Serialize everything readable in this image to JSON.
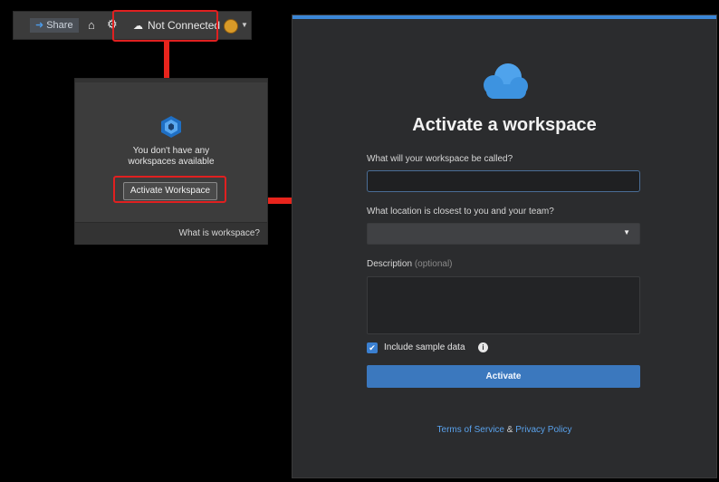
{
  "toolbar": {
    "share_label": "Share",
    "status_label": "Not Connected",
    "icons": [
      "share-arrow-icon",
      "home-icon",
      "gear-icon",
      "disconnected-icon",
      "avatar",
      "caret-down-icon"
    ]
  },
  "popup": {
    "message_line1": "You don't have any",
    "message_line2": "workspaces available",
    "button_label": "Activate Workspace",
    "footer_link": "What is workspace?"
  },
  "dialog": {
    "title": "Activate a workspace",
    "name_label": "What will your workspace be called?",
    "name_value": "",
    "location_label": "What location is closest to you and your team?",
    "location_value": "",
    "description_label": "Description",
    "description_optional": "(optional)",
    "description_value": "",
    "sample_data_label": "Include sample data",
    "sample_data_checked": true,
    "activate_label": "Activate",
    "terms_label": "Terms of Service",
    "amp": "&",
    "privacy_label": "Privacy Policy"
  },
  "colors": {
    "accent": "#3b86d6",
    "button": "#3b78be",
    "highlight_red": "#e02020",
    "link": "#5aa2ec"
  }
}
